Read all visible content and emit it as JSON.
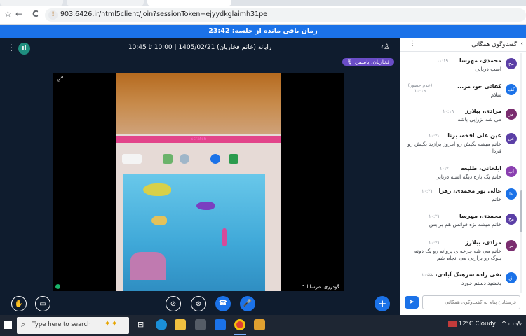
{
  "browser": {
    "url": "903.6426.ir/html5client/join?sessionToken=ejyydkglaimh31pe",
    "nav_back": "←",
    "nav_forward": "→",
    "nav_reload": "C",
    "nav_star": "☆",
    "warn_icon": "!"
  },
  "banner": {
    "text": "زمان باقی مانده از جلسه: 23:42"
  },
  "meeting": {
    "title": "رایانه (خانم فخاریان) 1405/02/21 | 10:00 تا 10:45",
    "presenter_badge": "فخاریان، یاسمن",
    "video_caption": "گودرزی، مرسانا",
    "scratch_bar_text": "Scratch"
  },
  "controls": {
    "hand_icon": "✋",
    "screen_icon": "▭",
    "camera_off_icon": "⊘",
    "screenshare_off_icon": "⊗",
    "phone_icon": "☎",
    "mic_icon": "🎤",
    "plus_icon": "+"
  },
  "chat": {
    "title": "گفت‌وگوی همگانی",
    "placeholder": "فرستادن پیام به گفت‌وگوی همگانی",
    "send_icon": "➤",
    "menu_icon": "⋮",
    "back_icon": "‹",
    "messages": [
      {
        "avatar": "مح",
        "color": "#5b3fa6",
        "name": "محمدی، مهرسا",
        "time": "۱۰:۱۹",
        "text": "اسب دریایی"
      },
      {
        "avatar": "کف",
        "color": "#1b72e8",
        "name": "کفائی خو، مر...",
        "time": "(عدم حضور) ۱۰:۱۹",
        "text": "سلام"
      },
      {
        "avatar": "مر",
        "color": "#7a2d6f",
        "name": "مرادی، ببلارز",
        "time": "۱۰:۱۹",
        "text": "می شه بزرایی باشه"
      },
      {
        "avatar": "عی",
        "color": "#5b3fa6",
        "name": "عین علی افخه، برنا",
        "time": "۱۰:۲۰",
        "text": "خانم میشه بکیش رو امروز برازید بکیش رو فردا"
      },
      {
        "avatar": "اب",
        "color": "#8a3fb0",
        "name": "ابلخانی، طلیعه",
        "time": "۱۰:۲۰",
        "text": "خانم یک باره دیگه اسبه دریایی"
      },
      {
        "avatar": "عا",
        "color": "#1b72e8",
        "name": "عالی پور محمدی، زهرا",
        "time": "۱۰:۲۱",
        "text": "خانم"
      },
      {
        "avatar": "مح",
        "color": "#5b3fa6",
        "name": "محمدی، مهرسا",
        "time": "۱۰:۲۱",
        "text": "خانم میشه بزه قوانس هم برابس"
      },
      {
        "avatar": "مر",
        "color": "#7a2d6f",
        "name": "مرادی، ببلارز",
        "time": "۱۰:۲۱",
        "text": "خانم می شه جرخه ی پروانه رو یک دونه بلوک رو برازیی می انجام شم"
      },
      {
        "avatar": "نق",
        "color": "#1b72e8",
        "name": "نقی زاده سرهنگ آبادی، ...",
        "time": "۱۰:۲۱",
        "text": "بخشید دستم خورد"
      }
    ]
  },
  "taskbar": {
    "search_placeholder": "Type here to search",
    "search_icon": "⌕",
    "weather": "12°C  Cloudy",
    "tray_icons": "^  ▭  ⁂"
  },
  "colors": {
    "accent": "#1b72e8",
    "meeting_bg": "#0f1c2e",
    "badge": "#6a4dc7"
  }
}
